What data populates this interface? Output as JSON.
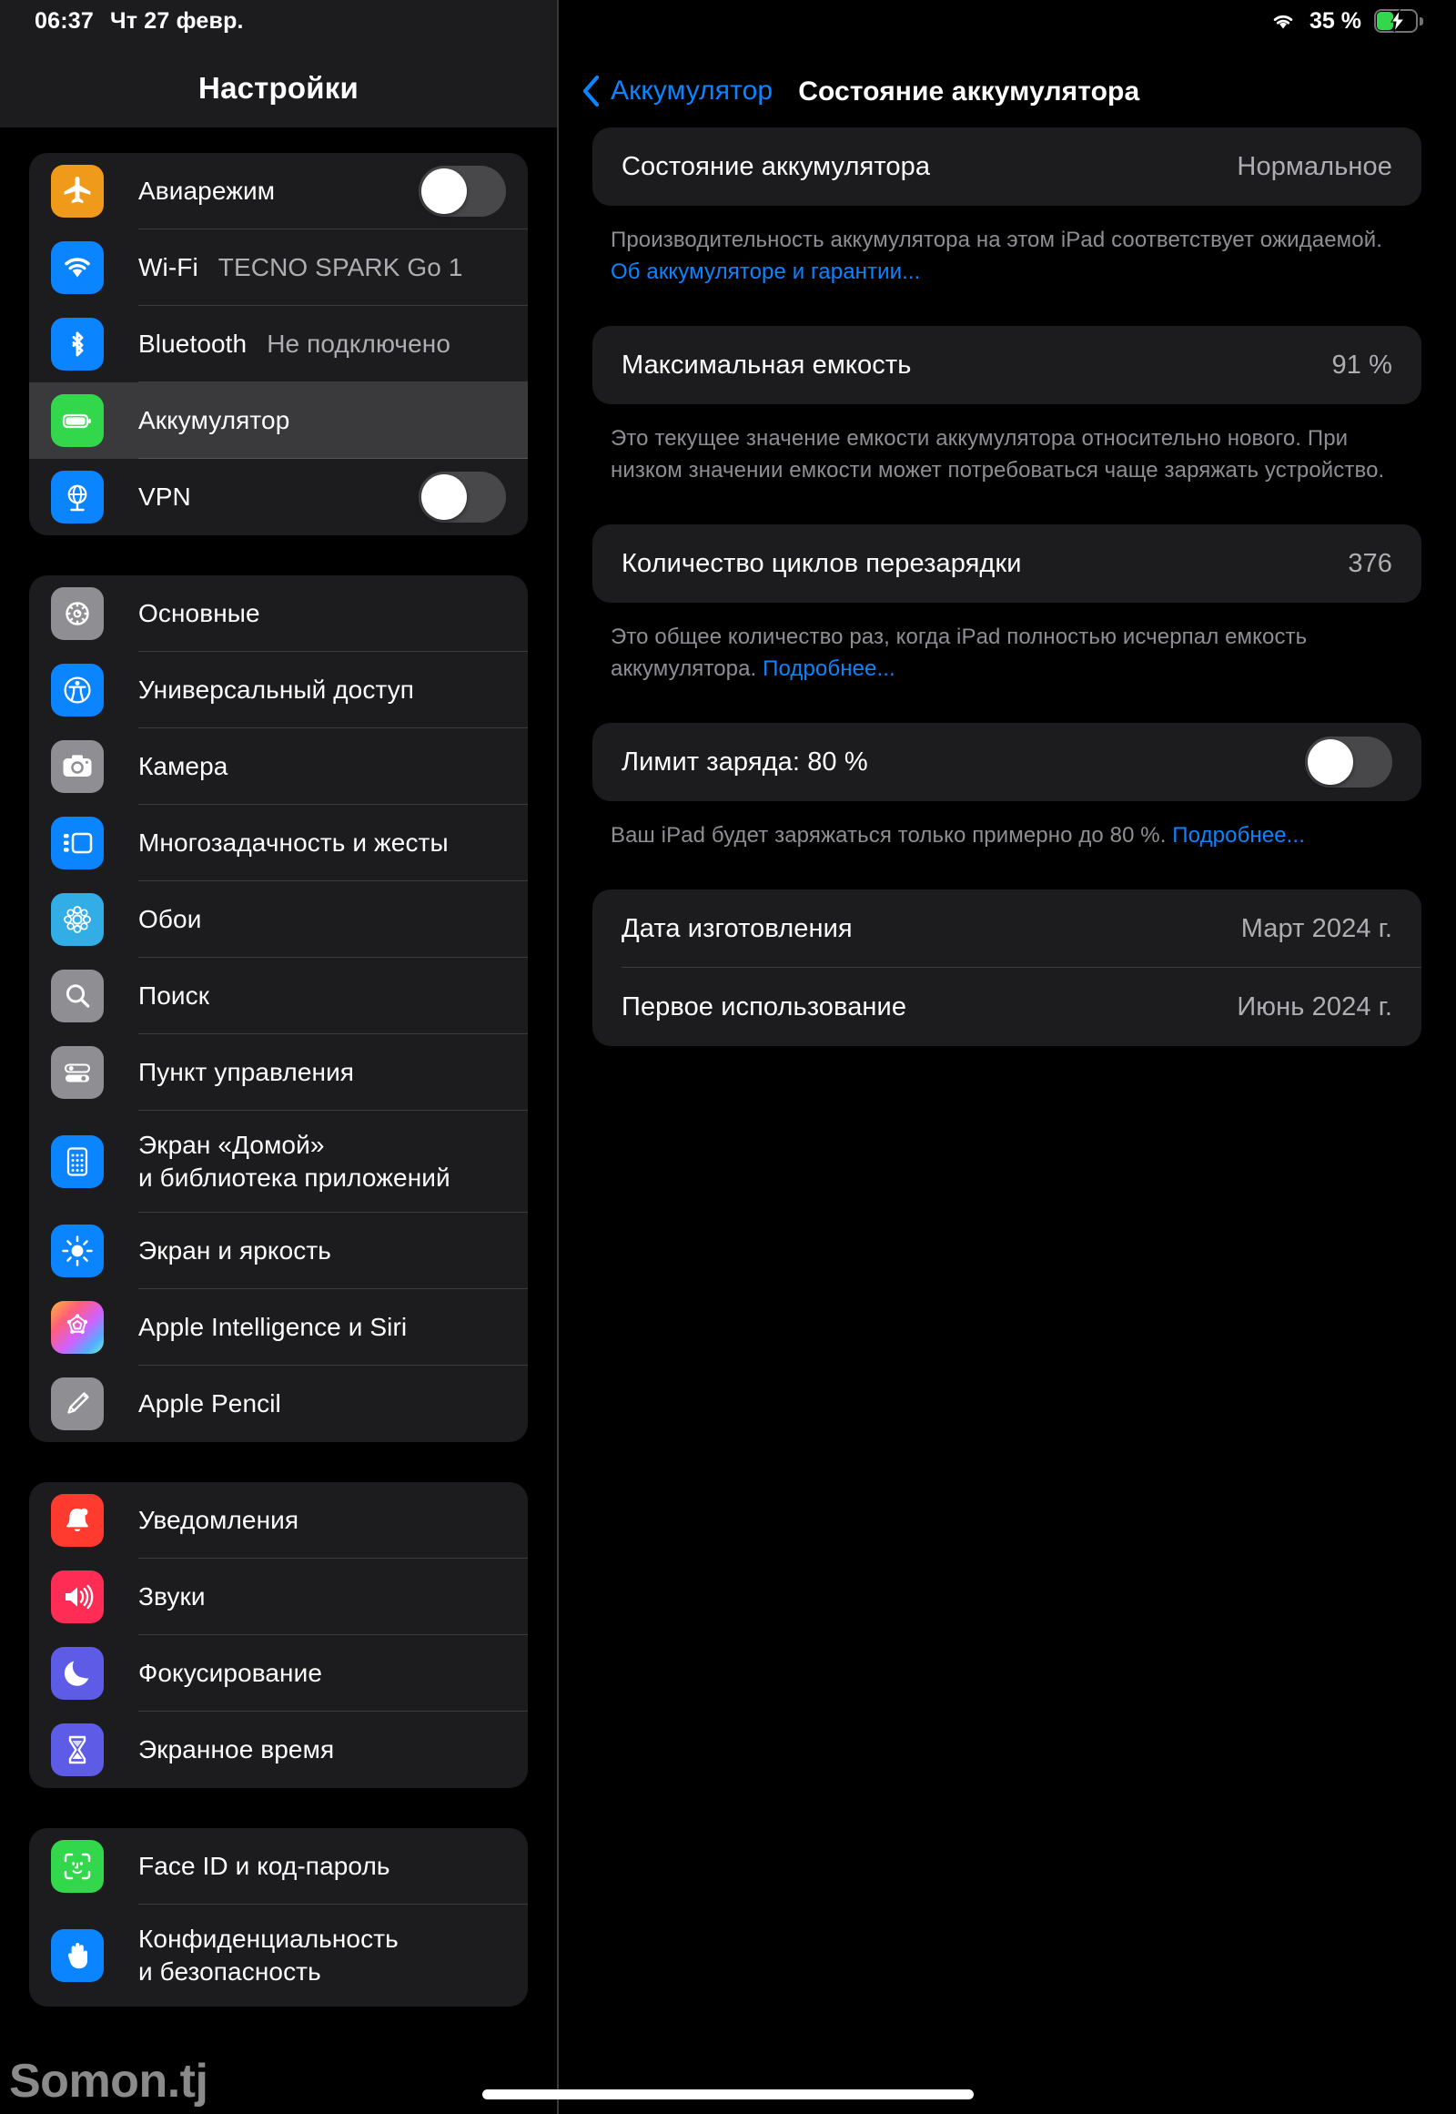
{
  "status_bar": {
    "time": "06:37",
    "date": "Чт 27 февр.",
    "battery_percent": "35 %",
    "wifi_icon": "wifi-icon",
    "battery_icon": "battery-charging-icon",
    "battery_charging": true,
    "battery_fill_color": "#32d74b"
  },
  "sidebar": {
    "title": "Настройки",
    "groups": [
      {
        "items": [
          {
            "label": "Авиарежим",
            "icon": "airplane-icon",
            "icon_color": "#f09a1b",
            "control": "switch",
            "switch_on": false
          },
          {
            "label": "Wi-Fi",
            "icon": "wifi-icon",
            "icon_color": "#0a84ff",
            "value": "TECNO SPARK Go 1"
          },
          {
            "label": "Bluetooth",
            "icon": "bluetooth-icon",
            "icon_color": "#0a84ff",
            "value": "Не подключено"
          },
          {
            "label": "Аккумулятор",
            "icon": "battery-icon",
            "icon_color": "#32d74b",
            "selected": true
          },
          {
            "label": "VPN",
            "icon": "vpn-globe-icon",
            "icon_color": "#0a84ff",
            "control": "switch",
            "switch_on": false
          }
        ]
      },
      {
        "items": [
          {
            "label": "Основные",
            "icon": "gear-icon",
            "icon_color": "#8e8e93"
          },
          {
            "label": "Универсальный доступ",
            "icon": "accessibility-icon",
            "icon_color": "#0a84ff"
          },
          {
            "label": "Камера",
            "icon": "camera-icon",
            "icon_color": "#8e8e93"
          },
          {
            "label": "Многозадачность и жесты",
            "icon": "multitasking-icon",
            "icon_color": "#0a84ff"
          },
          {
            "label": "Обои",
            "icon": "wallpaper-icon",
            "icon_color": "#32ade6"
          },
          {
            "label": "Поиск",
            "icon": "search-icon",
            "icon_color": "#8e8e93"
          },
          {
            "label": "Пункт управления",
            "icon": "control-center-icon",
            "icon_color": "#8e8e93"
          },
          {
            "label": "Экран «Домой»\nи библиотека приложений",
            "icon": "home-screen-icon",
            "icon_color": "#0a84ff",
            "two_line": true
          },
          {
            "label": "Экран и яркость",
            "icon": "brightness-icon",
            "icon_color": "#0a84ff"
          },
          {
            "label": "Apple Intelligence и Siri",
            "icon": "apple-intelligence-icon",
            "icon_color": "gradient"
          },
          {
            "label": "Apple Pencil",
            "icon": "pencil-icon",
            "icon_color": "#8e8e93"
          }
        ]
      },
      {
        "items": [
          {
            "label": "Уведомления",
            "icon": "bell-icon",
            "icon_color": "#ff3b30"
          },
          {
            "label": "Звуки",
            "icon": "speaker-icon",
            "icon_color": "#ff2d55"
          },
          {
            "label": "Фокусирование",
            "icon": "moon-icon",
            "icon_color": "#5e5ce6"
          },
          {
            "label": "Экранное время",
            "icon": "hourglass-icon",
            "icon_color": "#5e5ce6"
          }
        ]
      },
      {
        "items": [
          {
            "label": "Face ID и код-пароль",
            "icon": "faceid-icon",
            "icon_color": "#32d74b"
          },
          {
            "label": "Конфиденциальность\nи безопасность",
            "icon": "privacy-hand-icon",
            "icon_color": "#0a84ff",
            "two_line": true
          }
        ]
      }
    ]
  },
  "detail": {
    "back_label": "Аккумулятор",
    "back_icon": "chevron-left-icon",
    "title": "Состояние аккумулятора",
    "sections": [
      {
        "rows": [
          {
            "key": "Состояние аккумулятора",
            "value": "Нормальное"
          }
        ],
        "note": "Производительность аккумулятора на этом iPad соответствует ожидаемой. ",
        "note_link": "Об аккумуляторе и гарантии..."
      },
      {
        "rows": [
          {
            "key": "Максимальная емкость",
            "value": "91 %"
          }
        ],
        "note": "Это текущее значение емкости аккумулятора относительно нового. При низком значении емкости может потребоваться чаще заряжать устройство.",
        "note_link": ""
      },
      {
        "rows": [
          {
            "key": "Количество циклов перезарядки",
            "value": "376"
          }
        ],
        "note": "Это общее количество раз, когда iPad полностью исчерпал емкость аккумулятора. ",
        "note_link": "Подробнее..."
      },
      {
        "rows": [
          {
            "key": "Лимит заряда: 80 %",
            "control": "switch",
            "switch_on": false
          }
        ],
        "note": "Ваш iPad будет заряжаться только примерно до 80 %. ",
        "note_link": "Подробнее..."
      },
      {
        "rows": [
          {
            "key": "Дата изготовления",
            "value": "Март 2024 г."
          },
          {
            "key": "Первое использование",
            "value": "Июнь 2024 г."
          }
        ],
        "note": "",
        "note_link": ""
      }
    ]
  },
  "watermark": {
    "text": "Somon.tj"
  },
  "home_indicator": {
    "name": "home-indicator"
  }
}
